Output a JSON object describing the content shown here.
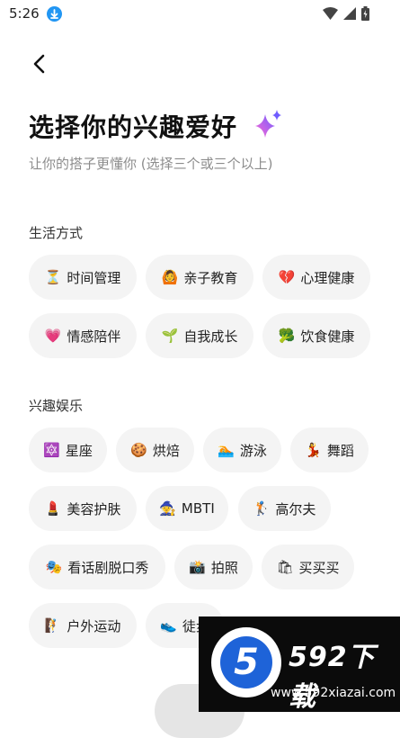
{
  "status_bar": {
    "time": "5:26"
  },
  "header": {
    "title": "选择你的兴趣爱好",
    "subtitle": "让你的搭子更懂你 (选择三个或三个以上)"
  },
  "sections": [
    {
      "title": "生活方式",
      "chips": [
        {
          "emoji": "⏳",
          "label": "时间管理"
        },
        {
          "emoji": "🙆",
          "label": "亲子教育"
        },
        {
          "emoji": "💔",
          "label": "心理健康"
        },
        {
          "emoji": "💗",
          "label": "情感陪伴"
        },
        {
          "emoji": "🌱",
          "label": "自我成长"
        },
        {
          "emoji": "🥦",
          "label": "饮食健康"
        }
      ]
    },
    {
      "title": "兴趣娱乐",
      "chips": [
        {
          "emoji": "🔯",
          "label": "星座"
        },
        {
          "emoji": "🍪",
          "label": "烘焙"
        },
        {
          "emoji": "🏊",
          "label": "游泳"
        },
        {
          "emoji": "💃",
          "label": "舞蹈"
        },
        {
          "emoji": "💄",
          "label": "美容护肤"
        },
        {
          "emoji": "🧙",
          "label": "MBTI"
        },
        {
          "emoji": "🏌",
          "label": "高尔夫"
        },
        {
          "emoji": "🎭",
          "label": "看话剧脱口秀"
        },
        {
          "emoji": "📸",
          "label": "拍照"
        },
        {
          "emoji": "🛍",
          "label": "买买买"
        },
        {
          "emoji": "🧗",
          "label": "户外运动"
        },
        {
          "emoji": "👟",
          "label": "徒步"
        }
      ]
    }
  ],
  "watermark": {
    "title": "592下载",
    "url": "www.592xiazai.com",
    "badge": "5"
  },
  "colors": {
    "chip_bg": "#f4f4f4",
    "sparkle_start": "#7b5cff",
    "sparkle_end": "#ff6ad5",
    "download_badge": "#2196f3"
  }
}
